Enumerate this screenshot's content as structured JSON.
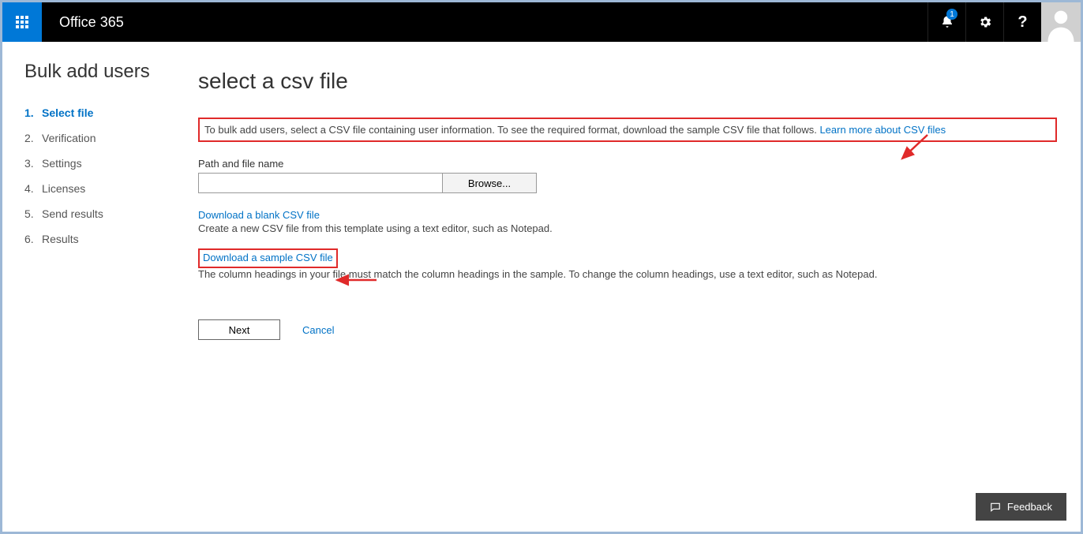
{
  "header": {
    "brand": "Office 365",
    "notification_count": "1"
  },
  "page": {
    "title": "Bulk add users"
  },
  "steps": [
    {
      "num": "1.",
      "label": "Select file",
      "active": true
    },
    {
      "num": "2.",
      "label": "Verification",
      "active": false
    },
    {
      "num": "3.",
      "label": "Settings",
      "active": false
    },
    {
      "num": "4.",
      "label": "Licenses",
      "active": false
    },
    {
      "num": "5.",
      "label": "Send results",
      "active": false
    },
    {
      "num": "6.",
      "label": "Results",
      "active": false
    }
  ],
  "main": {
    "heading": "select a csv file",
    "intro_text": "To bulk add users, select a CSV file containing user information. To see the required format, download the sample CSV file that follows. ",
    "intro_link": "Learn more about CSV files",
    "path_label": "Path and file name",
    "path_value": "",
    "browse_label": "Browse...",
    "dl_blank_link": "Download a blank CSV file",
    "dl_blank_desc": "Create a new CSV file from this template using a text editor, such as Notepad.",
    "dl_sample_link": "Download a sample CSV file",
    "dl_sample_desc": "The column headings in your file must match the column headings in the sample. To change the column headings, use a text editor, such as Notepad.",
    "next_label": "Next",
    "cancel_label": "Cancel"
  },
  "footer": {
    "feedback": "Feedback"
  }
}
